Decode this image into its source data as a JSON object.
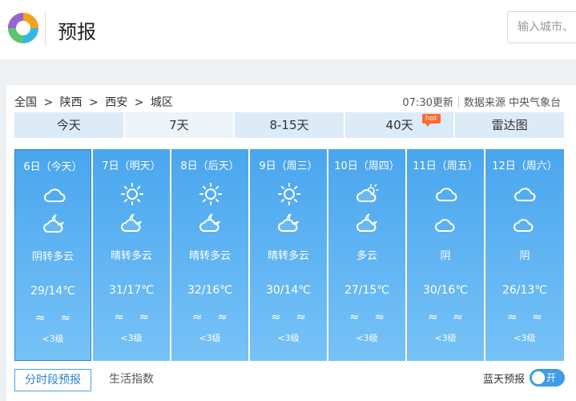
{
  "header": {
    "title": "预报",
    "search_placeholder": "输入城市、"
  },
  "breadcrumb": [
    "全国",
    ">",
    "陕西",
    ">",
    "西安",
    ">",
    "城区"
  ],
  "update": {
    "time": "07:30更新",
    "source": "数据来源 中央气象台"
  },
  "tabs": [
    {
      "label": "今天",
      "active": false
    },
    {
      "label": "7天",
      "active": true
    },
    {
      "label": "8-15天",
      "active": false
    },
    {
      "label": "40天",
      "active": false,
      "badge": "hot"
    },
    {
      "label": "雷达图",
      "active": false
    }
  ],
  "days": [
    {
      "date": "6日（今天）",
      "icon_day": "cloud-icon",
      "icon_night": "cloud-moon-icon",
      "desc": "阴转多云",
      "temp": "29/14℃",
      "wind": "≈ ≈",
      "level": "<3级"
    },
    {
      "date": "7日（明天）",
      "icon_day": "sun-icon",
      "icon_night": "cloud-moon-icon",
      "desc": "晴转多云",
      "temp": "31/17℃",
      "wind": "≈ ≈",
      "level": "<3级"
    },
    {
      "date": "8日（后天）",
      "icon_day": "sun-icon",
      "icon_night": "cloud-moon-icon",
      "desc": "晴转多云",
      "temp": "32/16℃",
      "wind": "≈ ≈",
      "level": "<3级"
    },
    {
      "date": "9日（周三）",
      "icon_day": "sun-icon",
      "icon_night": "cloud-moon-icon",
      "desc": "晴转多云",
      "temp": "30/14℃",
      "wind": "≈ ≈",
      "level": "<3级"
    },
    {
      "date": "10日（周四）",
      "icon_day": "sun-cloud-icon",
      "icon_night": "cloud-moon-icon",
      "desc": "多云",
      "temp": "27/15℃",
      "wind": "≈ ≈",
      "level": "<3级"
    },
    {
      "date": "11日（周五）",
      "icon_day": "cloud-icon",
      "icon_night": "moon-cloud-icon",
      "desc": "阴",
      "temp": "30/16℃",
      "wind": "≈ ≈",
      "level": "<3级"
    },
    {
      "date": "12日（周六）",
      "icon_day": "cloud-icon",
      "icon_night": "moon-cloud-icon",
      "desc": "阴",
      "temp": "26/13℃",
      "wind": "≈ ≈",
      "level": "<3级"
    }
  ],
  "bottom_tabs": [
    "分时段预报",
    "生活指数"
  ],
  "bluesky": {
    "label": "蓝天预报",
    "toggle": "开"
  },
  "colors": {
    "accent": "#3e9de6",
    "card_top": "#49a6ee",
    "card_bottom": "#77c2f7",
    "hot": "#ff6a2a"
  }
}
